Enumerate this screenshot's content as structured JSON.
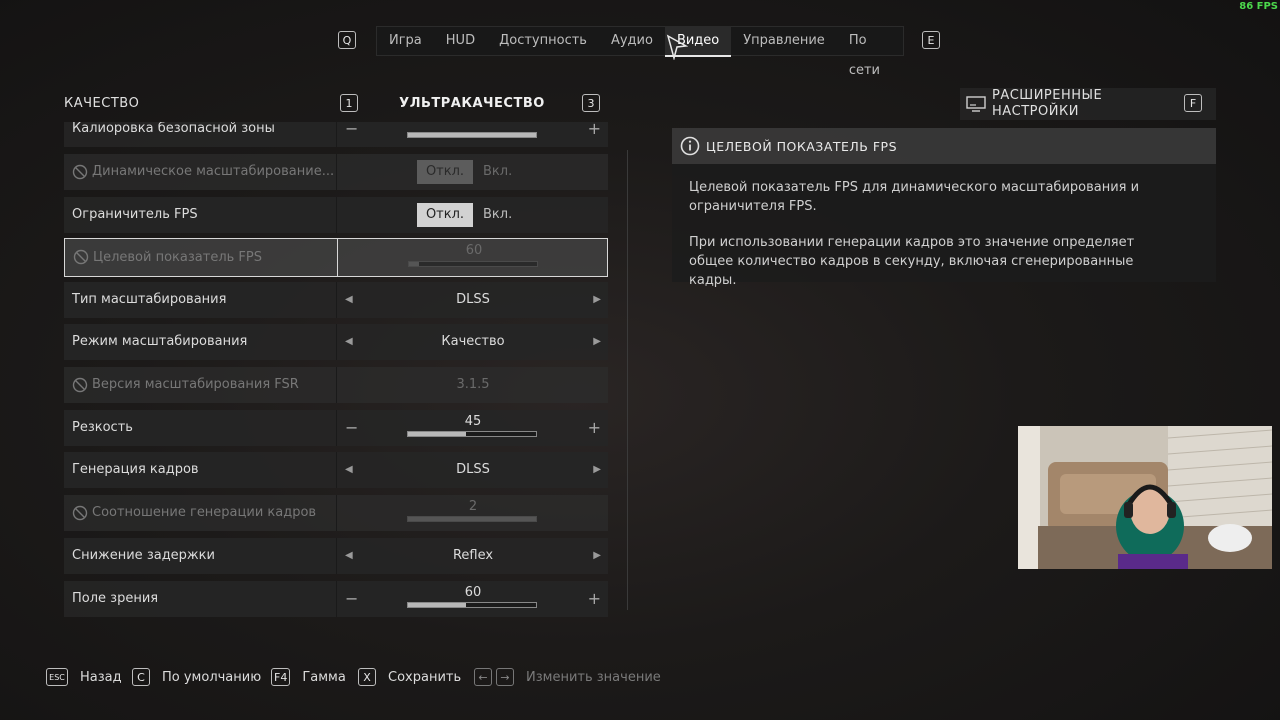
{
  "fps_counter": "86 FPS",
  "nav": {
    "left_key": "Q",
    "right_key": "E",
    "tabs": [
      {
        "label": "Игра"
      },
      {
        "label": "HUD"
      },
      {
        "label": "Доступность"
      },
      {
        "label": "Аудио"
      },
      {
        "label": "Видео",
        "active": true
      },
      {
        "label": "Управление"
      },
      {
        "label": "По сети"
      }
    ]
  },
  "preset": {
    "left_label": "КАЧЕСТВО",
    "prev_key": "1",
    "value": "УЛЬТРАКАЧЕСТВО",
    "next_key": "3"
  },
  "advanced": {
    "label_line1": "РАСШИРЕННЫЕ",
    "label_line2": "НАСТРОЙКИ",
    "key": "F"
  },
  "settings": [
    {
      "label": "Калиоровка безопасной зоны",
      "type": "slider",
      "value": "",
      "fill": 1.0
    },
    {
      "label": "Динамическое масштабирование...",
      "type": "toggle",
      "disabled": true,
      "off": "Откл.",
      "on": "Вкл."
    },
    {
      "label": "Ограничитель FPS",
      "type": "toggle",
      "off": "Откл.",
      "on": "Вкл."
    },
    {
      "label": "Целевой показатель FPS",
      "type": "slider",
      "disabled": true,
      "selected": true,
      "value": "60",
      "fill": 0.08
    },
    {
      "label": "Тип масштабирования",
      "type": "select",
      "value": "DLSS"
    },
    {
      "label": "Режим масштабирования",
      "type": "select",
      "value": "Качество"
    },
    {
      "label": "Версия масштабирования FSR",
      "type": "select",
      "disabled": true,
      "value": "3.1.5"
    },
    {
      "label": "Резкость",
      "type": "slider",
      "value": "45",
      "fill": 0.45
    },
    {
      "label": "Генерация кадров",
      "type": "select",
      "value": "DLSS"
    },
    {
      "label": "Соотношение генерации кадров",
      "type": "slider",
      "disabled": true,
      "value": "2",
      "fill": 1.0
    },
    {
      "label": "Снижение задержки",
      "type": "select",
      "value": "Reflex"
    },
    {
      "label": "Поле зрения",
      "type": "slider",
      "value": "60",
      "fill": 0.45
    }
  ],
  "info": {
    "title": "ЦЕЛЕВОЙ ПОКАЗАТЕЛЬ FPS",
    "p1": "Целевой показатель FPS для динамического масштабирования и ограничителя FPS.",
    "p2": "При использовании генерации кадров это значение определяет общее количество кадров в секунду, включая сгенерированные кадры."
  },
  "footer": [
    {
      "key": "ESC",
      "label": "Назад"
    },
    {
      "key": "C",
      "label": "По умолчанию"
    },
    {
      "key": "F4",
      "label": "Гамма"
    },
    {
      "key": "X",
      "label": "Сохранить"
    },
    {
      "key": "←→",
      "label": "Изменить значение",
      "dim": true
    }
  ]
}
